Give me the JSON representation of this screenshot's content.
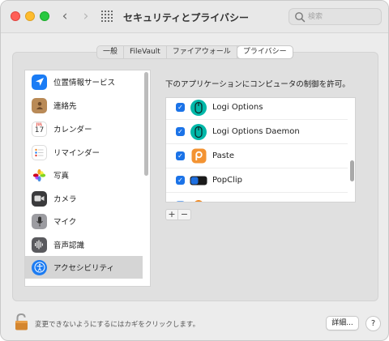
{
  "window": {
    "title": "セキュリティとプライバシー",
    "search_placeholder": "検索"
  },
  "tabs": [
    {
      "label": "一般",
      "active": false
    },
    {
      "label": "FileVault",
      "active": false
    },
    {
      "label": "ファイアウォール",
      "active": false
    },
    {
      "label": "プライバシー",
      "active": true
    }
  ],
  "sidebar": {
    "items": [
      {
        "label": "位置情報サービス",
        "icon": "location-arrow-icon",
        "color": "#1a7cf5"
      },
      {
        "label": "連絡先",
        "icon": "contacts-icon",
        "color": "#b98a57"
      },
      {
        "label": "カレンダー",
        "icon": "calendar-icon",
        "color": "#ffffff",
        "day": "17",
        "month": "JUL"
      },
      {
        "label": "リマインダー",
        "icon": "reminders-icon",
        "color": "#ffffff"
      },
      {
        "label": "写真",
        "icon": "photos-icon",
        "color": "#ffffff"
      },
      {
        "label": "カメラ",
        "icon": "camera-icon",
        "color": "#3a3a3c"
      },
      {
        "label": "マイク",
        "icon": "microphone-icon",
        "color": "#9c9ca1"
      },
      {
        "label": "音声認識",
        "icon": "speech-recognition-icon",
        "color": "#5a5a5e"
      },
      {
        "label": "アクセシビリティ",
        "icon": "accessibility-icon",
        "color": "#1d7cf2",
        "selected": true
      }
    ]
  },
  "detail": {
    "title": "下のアプリケーションにコンピュータの制御を許可。",
    "apps": [
      {
        "label": "Logi Options",
        "checked": true,
        "icon": "logi-options-icon",
        "color": "#00b8a9"
      },
      {
        "label": "Logi Options Daemon",
        "checked": true,
        "icon": "logi-options-daemon-icon",
        "color": "#00b8a9"
      },
      {
        "label": "Paste",
        "checked": true,
        "icon": "paste-app-icon",
        "color": "#f39332"
      },
      {
        "label": "PopClip",
        "checked": true,
        "icon": "popclip-icon",
        "color": "#1e6fe0"
      }
    ],
    "add_label": "+",
    "remove_label": "−"
  },
  "footer": {
    "lock_text": "変更できないようにするにはカギをクリックします。",
    "details_label": "詳細...",
    "help_label": "?"
  }
}
